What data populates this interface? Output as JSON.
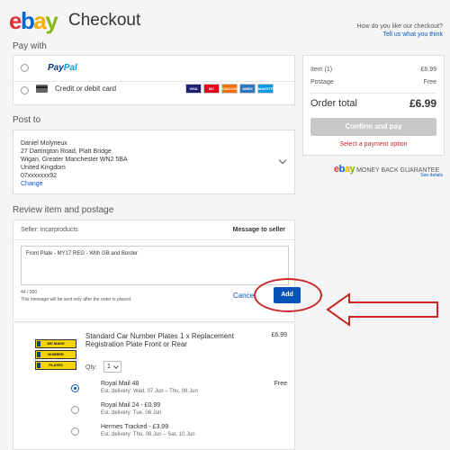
{
  "header": {
    "logo": [
      "e",
      "b",
      "a",
      "y"
    ],
    "title": "Checkout",
    "feedback_question": "How do you like our checkout?",
    "feedback_link": "Tell us what you think"
  },
  "pay_with": {
    "title": "Pay with",
    "paypal_part1": "Pay",
    "paypal_part2": "Pal",
    "card_label": "Credit or debit card",
    "card_brands": [
      {
        "name": "VISA",
        "color": "#1a1f71"
      },
      {
        "name": "MC",
        "color": "#eb001b"
      },
      {
        "name": "DISCOVER",
        "color": "#f76f00"
      },
      {
        "name": "AMEX",
        "color": "#2e77bc"
      },
      {
        "name": "MAESTRO",
        "color": "#0099df"
      }
    ]
  },
  "post_to": {
    "title": "Post to",
    "name": "Daniel Molyneux",
    "line1": "27 Dartington Road, Platt Bridge",
    "line2": "Wigan, Greater Manchester WN2 5BA",
    "country": "United Kingdom",
    "phone": "07xxxxxxx92",
    "change_link": "Change"
  },
  "review": {
    "title": "Review item and postage",
    "seller": "Seller: incarproducts",
    "message_to_seller": "Message to seller",
    "message_text": "Front Plate - MY17 REG - With GB and Border",
    "char_count": "44 / 500",
    "note": "This message will be sent only after the order is placed.",
    "cancel_label": "Cancel",
    "add_label": "Add"
  },
  "item": {
    "plates": [
      "WE MAKE",
      "NUMBER",
      "PLATES"
    ],
    "title": "Standard Car Number Plates 1 x Replacement Registration Plate Front or Rear",
    "price": "£6.99",
    "qty_label": "Qty:",
    "qty_value": "1",
    "shipping": [
      {
        "name": "Royal Mail 48",
        "est": "Est. delivery: Wed, 07 Jun – Thu, 08 Jun",
        "cost": "Free",
        "selected": true
      },
      {
        "name": "Royal Mail 24 - £0.99",
        "est": "Est. delivery: Tue, 06 Jun",
        "cost": "",
        "selected": false
      },
      {
        "name": "Hermes Tracked - £3.99",
        "est": "Est. delivery: Thu, 08 Jun – Sat, 10 Jun",
        "cost": "",
        "selected": false
      }
    ]
  },
  "summary": {
    "item_label": "Item (1)",
    "item_value": "£6.99",
    "postage_label": "Postage",
    "postage_value": "Free",
    "total_label": "Order total",
    "total_value": "£6.99",
    "confirm_label": "Confirm and pay",
    "select_payment": "Select a payment option"
  },
  "guarantee": {
    "text": "MONEY BACK GUARANTEE",
    "see_details": "See details"
  }
}
